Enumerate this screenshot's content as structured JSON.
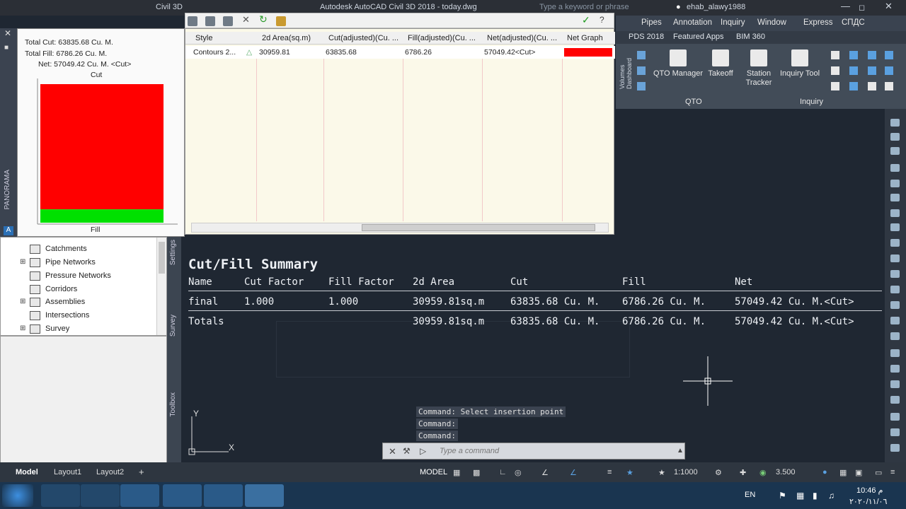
{
  "topbar": {
    "app_title": "Autodesk AutoCAD Civil 3D 2018 - today.dwg",
    "doc_tab": "Civil 3D",
    "search_placeholder": "Type a keyword or phrase",
    "user": "ehab_alawy1988"
  },
  "menubar": {
    "items": [
      "Pipes",
      "Annotation",
      "Inquiry",
      "Window",
      "Express",
      "СПДС"
    ]
  },
  "ribbon_tabs": {
    "items": [
      "PDS 2018",
      "Featured Apps",
      "BIM 360"
    ]
  },
  "ribbon": {
    "buttons": [
      "QTO Manager",
      "Takeoff",
      "Station Tracker",
      "Inquiry Tool"
    ],
    "panel_qto": "QTO",
    "panel_inquiry": "Inquiry",
    "side_label": "Volumes Dashboard"
  },
  "chart_panel": {
    "total_cut": "Total Cut: 63835.68 Cu. M.",
    "total_fill": "Total Fill: 6786.26 Cu. M.",
    "net": "Net: 57049.42 Cu. M. <Cut>",
    "cut_label": "Cut",
    "fill_label": "Fill",
    "side_label": "PANORAMA",
    "cut_color": "#ff0000",
    "fill_color": "#00e000"
  },
  "chart_data": {
    "type": "bar",
    "categories": [
      "Cut",
      "Fill"
    ],
    "values": [
      63835.68,
      6786.26
    ],
    "title": "",
    "xlabel": "",
    "ylabel": ""
  },
  "grid": {
    "headers": [
      "Style",
      "2d Area(sq.m)",
      "Cut(adjusted)(Cu. ...",
      "Fill(adjusted)(Cu. ...",
      "Net(adjusted)(Cu. ...",
      "Net Graph"
    ],
    "row": [
      "Contours 2...",
      "30959.81",
      "63835.68",
      "6786.26",
      "57049.42<Cut>"
    ],
    "net_graph_color": "#ff0000"
  },
  "prospector": {
    "items": [
      "Catchments",
      "Pipe Networks",
      "Pressure Networks",
      "Corridors",
      "Assemblies",
      "Intersections",
      "Survey"
    ]
  },
  "vtabs": [
    "Settings",
    "Survey",
    "Toolbox"
  ],
  "summary": {
    "title": "Cut/Fill Summary",
    "headers": [
      "Name",
      "Cut Factor",
      "Fill Factor",
      "2d Area",
      "Cut",
      "Fill",
      "Net"
    ],
    "row": [
      "final",
      "1.000",
      "1.000",
      "30959.81sq.m",
      "63835.68 Cu. M.",
      "6786.26 Cu. M.",
      "57049.42 Cu. M.<Cut>"
    ],
    "totals": [
      "Totals",
      "30959.81sq.m",
      "63835.68 Cu. M.",
      "6786.26 Cu. M.",
      "57049.42 Cu. M.<Cut>"
    ]
  },
  "command": {
    "history": [
      "Command: Select insertion point",
      "Command:",
      "Command:"
    ],
    "placeholder": "Type a command"
  },
  "ucs": {
    "x": "X",
    "y": "Y"
  },
  "statusbar": {
    "layout_tabs": [
      "Model",
      "Layout1",
      "Layout2"
    ],
    "add_tab": "+",
    "model_label": "MODEL",
    "scale": "1:1000",
    "value": "3.500"
  },
  "taskbar": {
    "lang": "EN",
    "time": "10:46 م",
    "date": "٢٠٢٠/١١/٠٦"
  }
}
